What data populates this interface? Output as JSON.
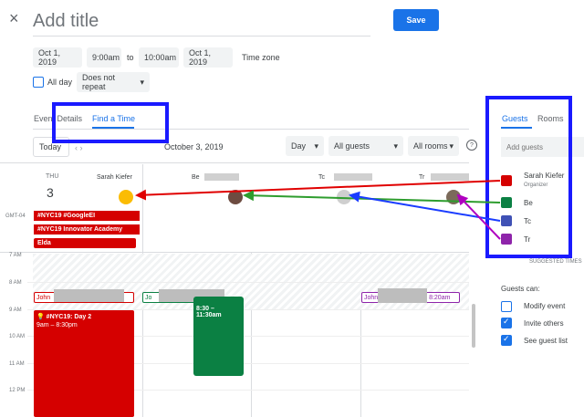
{
  "header": {
    "close_glyph": "×",
    "title_placeholder": "Add title",
    "save_label": "Save"
  },
  "datetime": {
    "start_date": "Oct 1, 2019",
    "start_time": "9:00am",
    "to": "to",
    "end_time": "10:00am",
    "end_date": "Oct 1, 2019",
    "timezone": "Time zone",
    "all_day": "All day",
    "repeat": "Does not repeat"
  },
  "tabs": {
    "event_details": "Event Details",
    "find_time": "Find a Time"
  },
  "toolbar": {
    "today": "Today",
    "date_range": "October 3, 2019",
    "view": "Day",
    "guests_filter": "All guests",
    "rooms_filter": "All rooms",
    "help": "?"
  },
  "columns": {
    "day": "THU",
    "date": "3",
    "person1": "Sarah Kiefer",
    "person2": "Be",
    "person3": "Tc",
    "person4": "Tr",
    "timezone": "GMT-04"
  },
  "allday_events": [
    "#NYC19 #GoogleEI",
    "#NYC19 Innovator Academy",
    "Elda"
  ],
  "hours": [
    "7 AM",
    "8 AM",
    "9 AM",
    "10 AM",
    "11 AM",
    "12 PM"
  ],
  "events": {
    "john1": "John",
    "john2": "Jo",
    "john3": "John",
    "john3_time": ", 8:20am",
    "day2_title": "#NYC19: Day 2",
    "day2_time": "9am – 8:30pm",
    "green_time": "8:30 – 11:30am"
  },
  "sidebar": {
    "tab_guests": "Guests",
    "tab_rooms": "Rooms",
    "add_guests_placeholder": "Add guests",
    "guests": [
      {
        "name": "Sarah Kiefer",
        "role": "Organizer",
        "color": "#d50000"
      },
      {
        "name": "Be",
        "role": "",
        "color": "#0b8043"
      },
      {
        "name": "Tc",
        "role": "",
        "color": "#3f51b5"
      },
      {
        "name": "Tr",
        "role": "",
        "color": "#8e24aa"
      }
    ],
    "suggested": "SUGGESTED TIMES",
    "guests_can": "Guests can:",
    "perms": [
      "Modify event",
      "Invite others",
      "See guest list"
    ]
  }
}
